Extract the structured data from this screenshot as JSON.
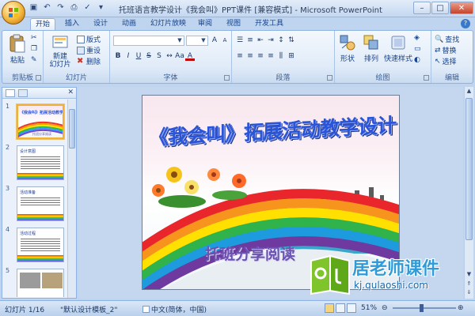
{
  "window": {
    "title": "托班语言教学设计《我会叫》PPT课件 [兼容模式] - Microsoft PowerPoint"
  },
  "quick_access": [
    "save-icon",
    "undo-icon",
    "redo-icon",
    "print-preview-icon",
    "spelling-icon",
    "customize-icon"
  ],
  "tabs": [
    {
      "label": "开始",
      "active": true
    },
    {
      "label": "插入"
    },
    {
      "label": "设计"
    },
    {
      "label": "动画"
    },
    {
      "label": "幻灯片放映"
    },
    {
      "label": "审阅"
    },
    {
      "label": "视图"
    },
    {
      "label": "开发工具"
    }
  ],
  "ribbon": {
    "clipboard": {
      "label": "剪贴板",
      "paste": "粘贴"
    },
    "slides": {
      "label": "幻灯片",
      "new_slide": "新建\n幻灯片",
      "layout": "版式",
      "reset": "重设",
      "delete": "删除"
    },
    "font": {
      "label": "字体"
    },
    "paragraph": {
      "label": "段落"
    },
    "drawing": {
      "label": "绘图",
      "shapes": "形状",
      "arrange": "排列",
      "quick_styles": "快速样式"
    },
    "editing": {
      "label": "编辑",
      "find": "查找",
      "replace": "替换",
      "select": "选择"
    }
  },
  "thumbnails": [
    {
      "number": "1",
      "selected": true,
      "title": "《我会叫》拓展活动教学设计",
      "subtitle": "托班分享阅读"
    },
    {
      "number": "2",
      "selected": false,
      "title": "设计意图"
    },
    {
      "number": "3",
      "selected": false,
      "title": "活动准备"
    },
    {
      "number": "4",
      "selected": false,
      "title": "活动过程"
    },
    {
      "number": "5",
      "selected": false,
      "title": ""
    }
  ],
  "slide": {
    "title": "《我会叫》拓展活动教学设计",
    "subtitle": "托班分享阅读"
  },
  "status": {
    "slide_info": "幻灯片 1/16",
    "theme": "\"默认设计模板_2\"",
    "language": "中文(简体，中国)",
    "zoom": "51%"
  },
  "watermark": {
    "brand": "居老师课件",
    "url": "kj.qulaoshi.com"
  },
  "colors": {
    "ribbon_bg": "#dfeaf7",
    "accent": "#15428b",
    "slide_title": "#2a55d8"
  }
}
